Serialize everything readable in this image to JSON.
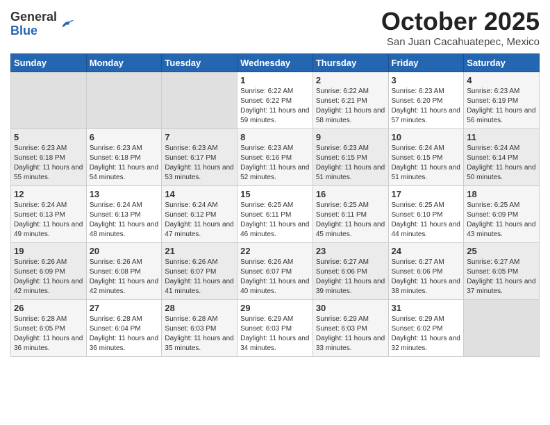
{
  "header": {
    "logo": {
      "general": "General",
      "blue": "Blue"
    },
    "title": "October 2025",
    "location": "San Juan Cacahuatepec, Mexico"
  },
  "weekdays": [
    "Sunday",
    "Monday",
    "Tuesday",
    "Wednesday",
    "Thursday",
    "Friday",
    "Saturday"
  ],
  "weeks": [
    [
      {
        "day": "",
        "sunrise": "",
        "sunset": "",
        "daylight": "",
        "empty": true
      },
      {
        "day": "",
        "sunrise": "",
        "sunset": "",
        "daylight": "",
        "empty": true
      },
      {
        "day": "",
        "sunrise": "",
        "sunset": "",
        "daylight": "",
        "empty": true
      },
      {
        "day": "1",
        "sunrise": "6:22 AM",
        "sunset": "6:22 PM",
        "daylight": "11 hours and 59 minutes."
      },
      {
        "day": "2",
        "sunrise": "6:22 AM",
        "sunset": "6:21 PM",
        "daylight": "11 hours and 58 minutes."
      },
      {
        "day": "3",
        "sunrise": "6:23 AM",
        "sunset": "6:20 PM",
        "daylight": "11 hours and 57 minutes."
      },
      {
        "day": "4",
        "sunrise": "6:23 AM",
        "sunset": "6:19 PM",
        "daylight": "11 hours and 56 minutes."
      }
    ],
    [
      {
        "day": "5",
        "sunrise": "6:23 AM",
        "sunset": "6:18 PM",
        "daylight": "11 hours and 55 minutes."
      },
      {
        "day": "6",
        "sunrise": "6:23 AM",
        "sunset": "6:18 PM",
        "daylight": "11 hours and 54 minutes."
      },
      {
        "day": "7",
        "sunrise": "6:23 AM",
        "sunset": "6:17 PM",
        "daylight": "11 hours and 53 minutes."
      },
      {
        "day": "8",
        "sunrise": "6:23 AM",
        "sunset": "6:16 PM",
        "daylight": "11 hours and 52 minutes."
      },
      {
        "day": "9",
        "sunrise": "6:23 AM",
        "sunset": "6:15 PM",
        "daylight": "11 hours and 51 minutes."
      },
      {
        "day": "10",
        "sunrise": "6:24 AM",
        "sunset": "6:15 PM",
        "daylight": "11 hours and 51 minutes."
      },
      {
        "day": "11",
        "sunrise": "6:24 AM",
        "sunset": "6:14 PM",
        "daylight": "11 hours and 50 minutes."
      }
    ],
    [
      {
        "day": "12",
        "sunrise": "6:24 AM",
        "sunset": "6:13 PM",
        "daylight": "11 hours and 49 minutes."
      },
      {
        "day": "13",
        "sunrise": "6:24 AM",
        "sunset": "6:13 PM",
        "daylight": "11 hours and 48 minutes."
      },
      {
        "day": "14",
        "sunrise": "6:24 AM",
        "sunset": "6:12 PM",
        "daylight": "11 hours and 47 minutes."
      },
      {
        "day": "15",
        "sunrise": "6:25 AM",
        "sunset": "6:11 PM",
        "daylight": "11 hours and 46 minutes."
      },
      {
        "day": "16",
        "sunrise": "6:25 AM",
        "sunset": "6:11 PM",
        "daylight": "11 hours and 45 minutes."
      },
      {
        "day": "17",
        "sunrise": "6:25 AM",
        "sunset": "6:10 PM",
        "daylight": "11 hours and 44 minutes."
      },
      {
        "day": "18",
        "sunrise": "6:25 AM",
        "sunset": "6:09 PM",
        "daylight": "11 hours and 43 minutes."
      }
    ],
    [
      {
        "day": "19",
        "sunrise": "6:26 AM",
        "sunset": "6:09 PM",
        "daylight": "11 hours and 42 minutes."
      },
      {
        "day": "20",
        "sunrise": "6:26 AM",
        "sunset": "6:08 PM",
        "daylight": "11 hours and 42 minutes."
      },
      {
        "day": "21",
        "sunrise": "6:26 AM",
        "sunset": "6:07 PM",
        "daylight": "11 hours and 41 minutes."
      },
      {
        "day": "22",
        "sunrise": "6:26 AM",
        "sunset": "6:07 PM",
        "daylight": "11 hours and 40 minutes."
      },
      {
        "day": "23",
        "sunrise": "6:27 AM",
        "sunset": "6:06 PM",
        "daylight": "11 hours and 39 minutes."
      },
      {
        "day": "24",
        "sunrise": "6:27 AM",
        "sunset": "6:06 PM",
        "daylight": "11 hours and 38 minutes."
      },
      {
        "day": "25",
        "sunrise": "6:27 AM",
        "sunset": "6:05 PM",
        "daylight": "11 hours and 37 minutes."
      }
    ],
    [
      {
        "day": "26",
        "sunrise": "6:28 AM",
        "sunset": "6:05 PM",
        "daylight": "11 hours and 36 minutes."
      },
      {
        "day": "27",
        "sunrise": "6:28 AM",
        "sunset": "6:04 PM",
        "daylight": "11 hours and 36 minutes."
      },
      {
        "day": "28",
        "sunrise": "6:28 AM",
        "sunset": "6:03 PM",
        "daylight": "11 hours and 35 minutes."
      },
      {
        "day": "29",
        "sunrise": "6:29 AM",
        "sunset": "6:03 PM",
        "daylight": "11 hours and 34 minutes."
      },
      {
        "day": "30",
        "sunrise": "6:29 AM",
        "sunset": "6:03 PM",
        "daylight": "11 hours and 33 minutes."
      },
      {
        "day": "31",
        "sunrise": "6:29 AM",
        "sunset": "6:02 PM",
        "daylight": "11 hours and 32 minutes."
      },
      {
        "day": "",
        "sunrise": "",
        "sunset": "",
        "daylight": "",
        "empty": true
      }
    ]
  ],
  "labels": {
    "sunrise_prefix": "Sunrise: ",
    "sunset_prefix": "Sunset: ",
    "daylight_prefix": "Daylight: "
  }
}
